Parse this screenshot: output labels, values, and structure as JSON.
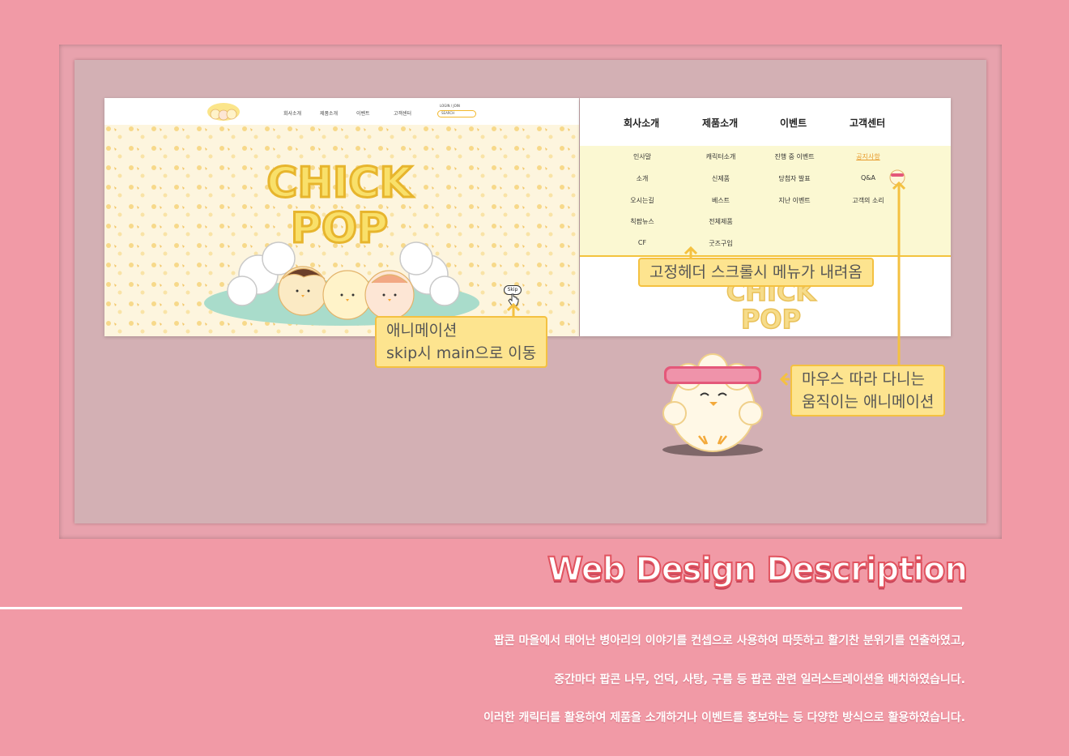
{
  "left_screen": {
    "nav": [
      "회사소개",
      "제품소개",
      "이벤트",
      "고객센터"
    ],
    "login": "LOGIN / JOIN",
    "search": "SEARCH",
    "hero_line1": "CHICK",
    "hero_line2": "POP",
    "skip": "Skip"
  },
  "right_screen": {
    "menu": [
      "회사소개",
      "제품소개",
      "이벤트",
      "고객센터"
    ],
    "col1": [
      "인사말",
      "소개",
      "오시는길",
      "칙팝뉴스",
      "CF"
    ],
    "col2": [
      "캐릭터소개",
      "신제품",
      "베스트",
      "전체제품",
      "굿즈구입"
    ],
    "col3": [
      "진행 중 이벤트",
      "당첨자 발표",
      "지난 이벤트"
    ],
    "col4": [
      "공지사항",
      "Q&A",
      "고객의 소리"
    ],
    "faded_logo_line1": "CHICK",
    "faded_logo_line2": "POP"
  },
  "callouts": {
    "header": "고정헤더 스크롤시 메뉴가 내려옴",
    "skip_line1": "애니메이션",
    "skip_line2": "skip시 main으로 이동",
    "mouse_line1": "마우스 따라 다니는",
    "mouse_line2": "움직이는 애니메이션"
  },
  "title": "Web Design Description",
  "description": [
    "팝콘 마을에서 태어난 병아리의 이야기를 컨셉으로 사용하여 따뜻하고 활기찬 분위기를 연출하였고,",
    "중간마다 팝콘 나무, 언덕, 사탕, 구름 등 팝콘 관련 일러스트레이션을 배치하였습니다.",
    "이러한 캐릭터를 활용하여 제품을 소개하거나 이벤트를 홍보하는 등 다양한 방식으로 활용하였습니다."
  ],
  "colors": {
    "background": "#f19aa6",
    "accent": "#f4c141",
    "title_stroke": "#e1535f"
  }
}
